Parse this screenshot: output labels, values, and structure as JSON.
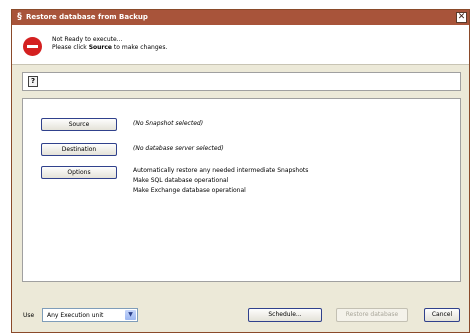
{
  "window": {
    "title": "Restore database from Backup",
    "title_icon": "§",
    "close_glyph": "✕"
  },
  "status": {
    "line1": "Not Ready to execute...",
    "line2_prefix": "Please click ",
    "line2_bold": "Source",
    "line2_suffix": " to make changes."
  },
  "help": {
    "icon_glyph": "?"
  },
  "actions": {
    "source_label": "Source",
    "source_note": "(No Snapshot selected)",
    "destination_label": "Destination",
    "destination_note": "(No database server selected)",
    "options_label": "Options",
    "options_lines": [
      "Automatically restore any needed intermediate Snapshots",
      "Make SQL database operational",
      "Make Exchange database operational"
    ]
  },
  "footer": {
    "use_label": "Use",
    "use_value": "Any Execution unit",
    "schedule_label": "Schedule...",
    "restore_label": "Restore database",
    "cancel_label": "Cancel"
  },
  "colors": {
    "titlebar": "#a8543a",
    "stop_icon": "#d42020",
    "button_border": "#30418c"
  },
  "icons": {
    "title": "app-icon",
    "status": "stop-icon",
    "help": "help-icon",
    "dropdown": "chevron-down-icon",
    "close": "close-icon"
  }
}
